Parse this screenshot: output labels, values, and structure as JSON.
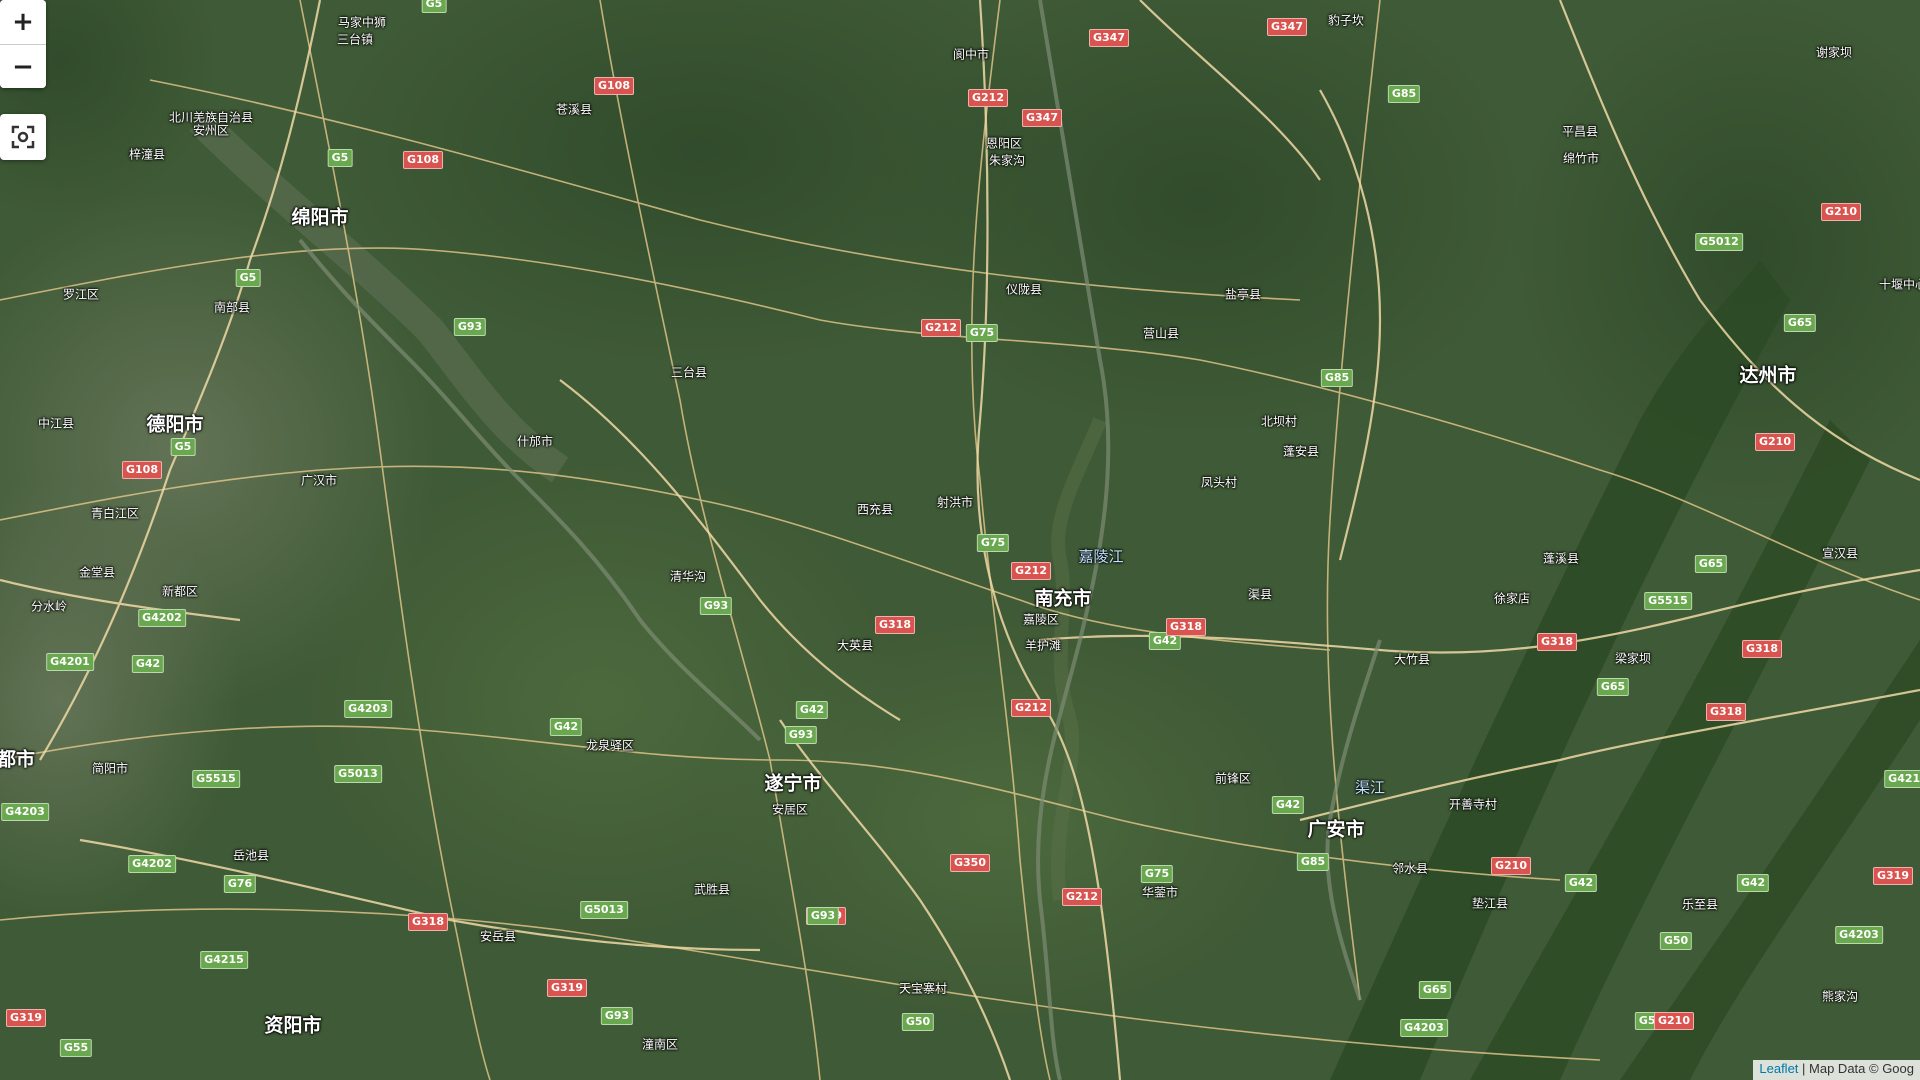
{
  "map": {
    "controls": {
      "zoom_in": "+",
      "zoom_out": "−",
      "locate_icon": "fullscreen-focus-icon"
    },
    "attribution": {
      "leaflet": "Leaflet",
      "separator": " | ",
      "text": "Map Data © Goog"
    },
    "colors": {
      "national_highway": "#d9534f",
      "expressway": "#6aa84f",
      "road_line": "#e6c98c"
    },
    "cities": [
      "绵阳市",
      "德阳市",
      "南充市",
      "遂宁市",
      "广安市",
      "达州市",
      "资阳市",
      "都市"
    ],
    "towns": [
      "马家中狮",
      "三台镇",
      "北川羌族自治县",
      "安州区",
      "梓潼县",
      "苍溪县",
      "阆中市",
      "朱家沟",
      "恩阳区",
      "豹子坎",
      "谢家坝",
      "平昌县",
      "绵竹市",
      "罗江区",
      "南部县",
      "仪陇县",
      "营山县",
      "盐亭县",
      "三台县",
      "什邡市",
      "中江县",
      "广汉市",
      "青白江区",
      "金堂县",
      "新都区",
      "分水岭",
      "北坝村",
      "蓬安县",
      "凤头村",
      "西充县",
      "射洪市",
      "清华沟",
      "嘉陵区",
      "羊护滩",
      "渠县",
      "徐家店",
      "大竹县",
      "梁家坝",
      "蓬溪县",
      "大英县",
      "龙泉驿区",
      "简阳市",
      "岳池县",
      "前锋区",
      "开善寺村",
      "安居区",
      "武胜县",
      "华蓥市",
      "邻水县",
      "垫江县",
      "乐至县",
      "安岳县",
      "潼南区",
      "天宝寨村",
      "熊家沟",
      "宣汉县",
      "十堰中心"
    ],
    "rivers": [
      "嘉陵江",
      "渠江"
    ],
    "shields": [
      "G5",
      "G108",
      "G212",
      "G347",
      "G347",
      "G85",
      "G5",
      "G108",
      "G212",
      "G347",
      "G5012",
      "G210",
      "G5",
      "G93",
      "G212",
      "G75",
      "G85",
      "G65",
      "G108",
      "G5",
      "G210",
      "G75",
      "G212",
      "G93",
      "G318",
      "G42",
      "G318",
      "G65",
      "G5515",
      "G318",
      "G318",
      "G4202",
      "G4201",
      "G42",
      "G4203",
      "G42",
      "G42",
      "G93",
      "G65",
      "G212",
      "G318",
      "G5515",
      "G5013",
      "G4203",
      "G4215",
      "G42",
      "G85",
      "G4202",
      "G76",
      "G350",
      "G75",
      "G212",
      "G210",
      "G42",
      "G319",
      "G5013",
      "G318",
      "G93",
      "G4203",
      "G65",
      "G50",
      "G42",
      "G50",
      "G319",
      "G319",
      "G93",
      "G50",
      "G210",
      "G4203",
      "G4215",
      "G319",
      "G55"
    ]
  }
}
